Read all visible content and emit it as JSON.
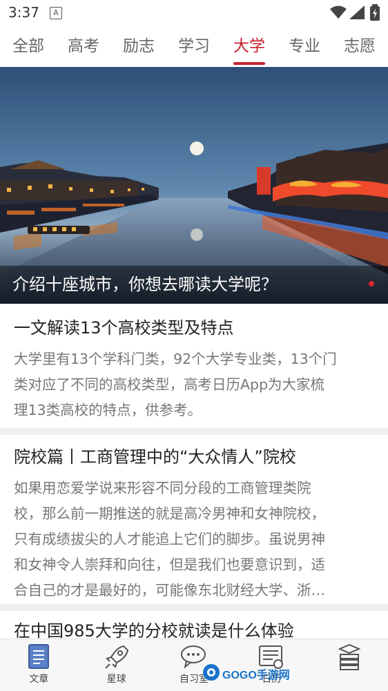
{
  "status_bar": {
    "time": "3:37",
    "notification_icon": "A"
  },
  "tabs": [
    {
      "label": "全部"
    },
    {
      "label": "高考"
    },
    {
      "label": "励志"
    },
    {
      "label": "学习"
    },
    {
      "label": "大学"
    },
    {
      "label": "专业"
    },
    {
      "label": "志愿"
    }
  ],
  "active_tab": "大学",
  "hero": {
    "title": "介绍十座城市，你想去哪读大学呢？",
    "image": "night-river-city-with-moon"
  },
  "articles": [
    {
      "title": "一文解读13个高校类型及特点",
      "summary_lines": [
        "大学里有13个学科门类，92个大学专业类，13个门",
        "类对应了不同的高校类型，高考日历App为大家梳",
        "理13类高校的特点，供参考。"
      ]
    },
    {
      "title": "院校篇丨工商管理中的“大众情人”院校",
      "summary_lines": [
        "如果用恋爱学说来形容不同分段的工商管理类院",
        "校，那么前一期推送的就是高冷男神和女神院校，",
        "只有成绩拔尖的人才能追上它们的脚步。虽说男神",
        "和女神令人崇拜和向往，但是我们也要意识到，适",
        "合自己的才是最好的，可能像东北财经大学、浙…"
      ]
    },
    {
      "title": "在中国985大学的分校就读是什么体验",
      "summary_lines": []
    }
  ],
  "bottom_nav": [
    {
      "label": "文章",
      "icon": "document-icon"
    },
    {
      "label": "星球",
      "icon": "rocket-icon"
    },
    {
      "label": "自习室",
      "icon": "chat-bubble-icon"
    },
    {
      "label": "日历",
      "icon": "calendar-list-icon"
    },
    {
      "label": "",
      "icon": "book-stack-icon"
    }
  ],
  "watermark": {
    "text": "GOGO手游网"
  },
  "colors": {
    "accent": "#c8202c",
    "text": "#222222",
    "summary": "#777777"
  }
}
